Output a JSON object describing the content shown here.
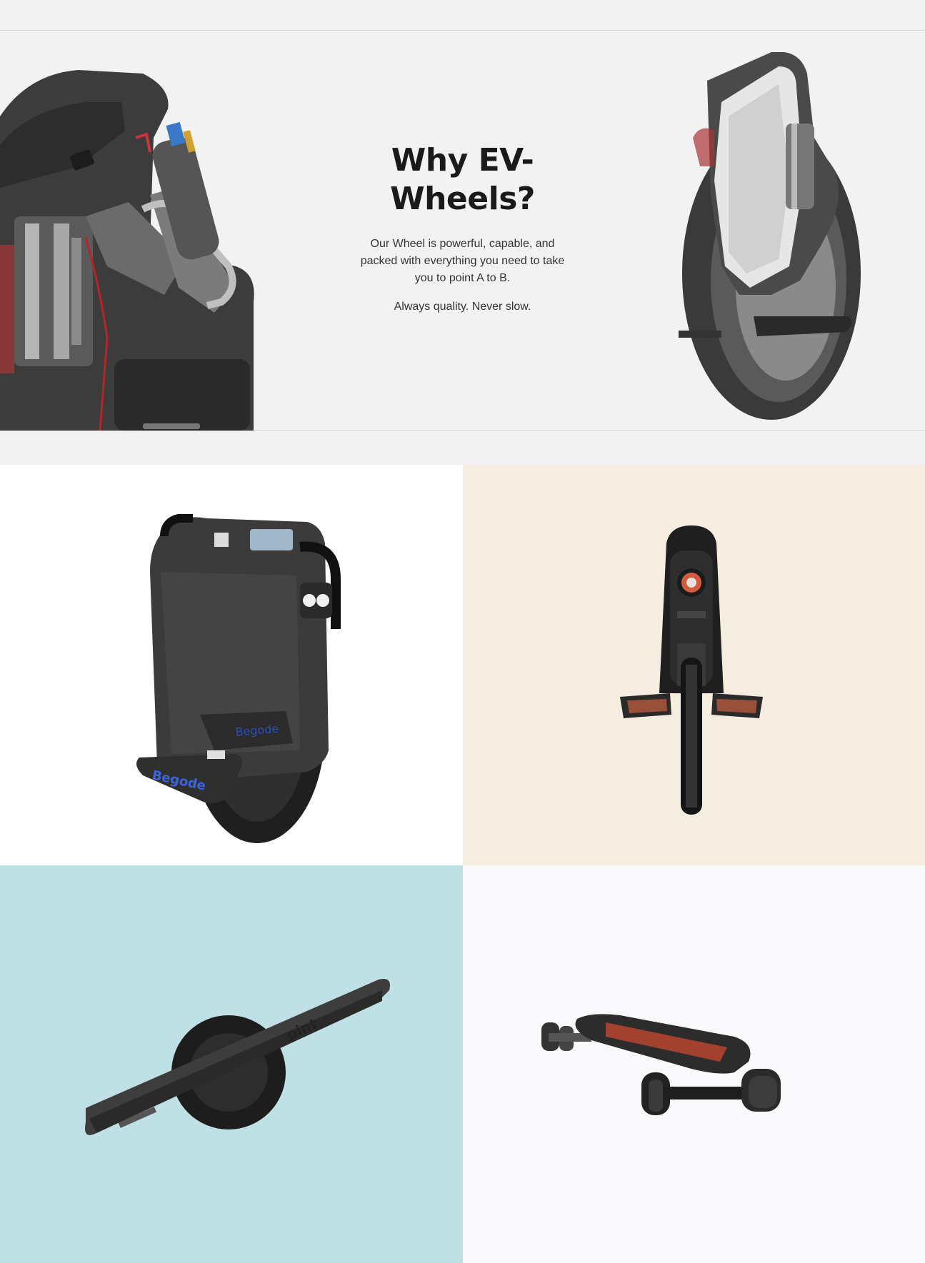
{
  "hero": {
    "title": "Why EV-Wheels?",
    "description": "Our Wheel is powerful, capable, and packed with everything you need to take you to point A to B.",
    "tagline": "Always quality. Never slow."
  },
  "products": [
    {
      "name": "electric-unicycle-black-wide",
      "background": "#ffffff",
      "logo_text": "Begode"
    },
    {
      "name": "electric-unicycle-front-view",
      "background": "#f4ede0"
    },
    {
      "name": "onewheel-pint",
      "background": "#bfe1e6",
      "logo_text": "pint",
      "side_text": "onewheel"
    },
    {
      "name": "electric-skateboard",
      "background": "#f9f9fb"
    }
  ],
  "colors": {
    "page_bg": "#f2f2f2",
    "title": "#1a1a1a",
    "body_text": "#333333"
  }
}
